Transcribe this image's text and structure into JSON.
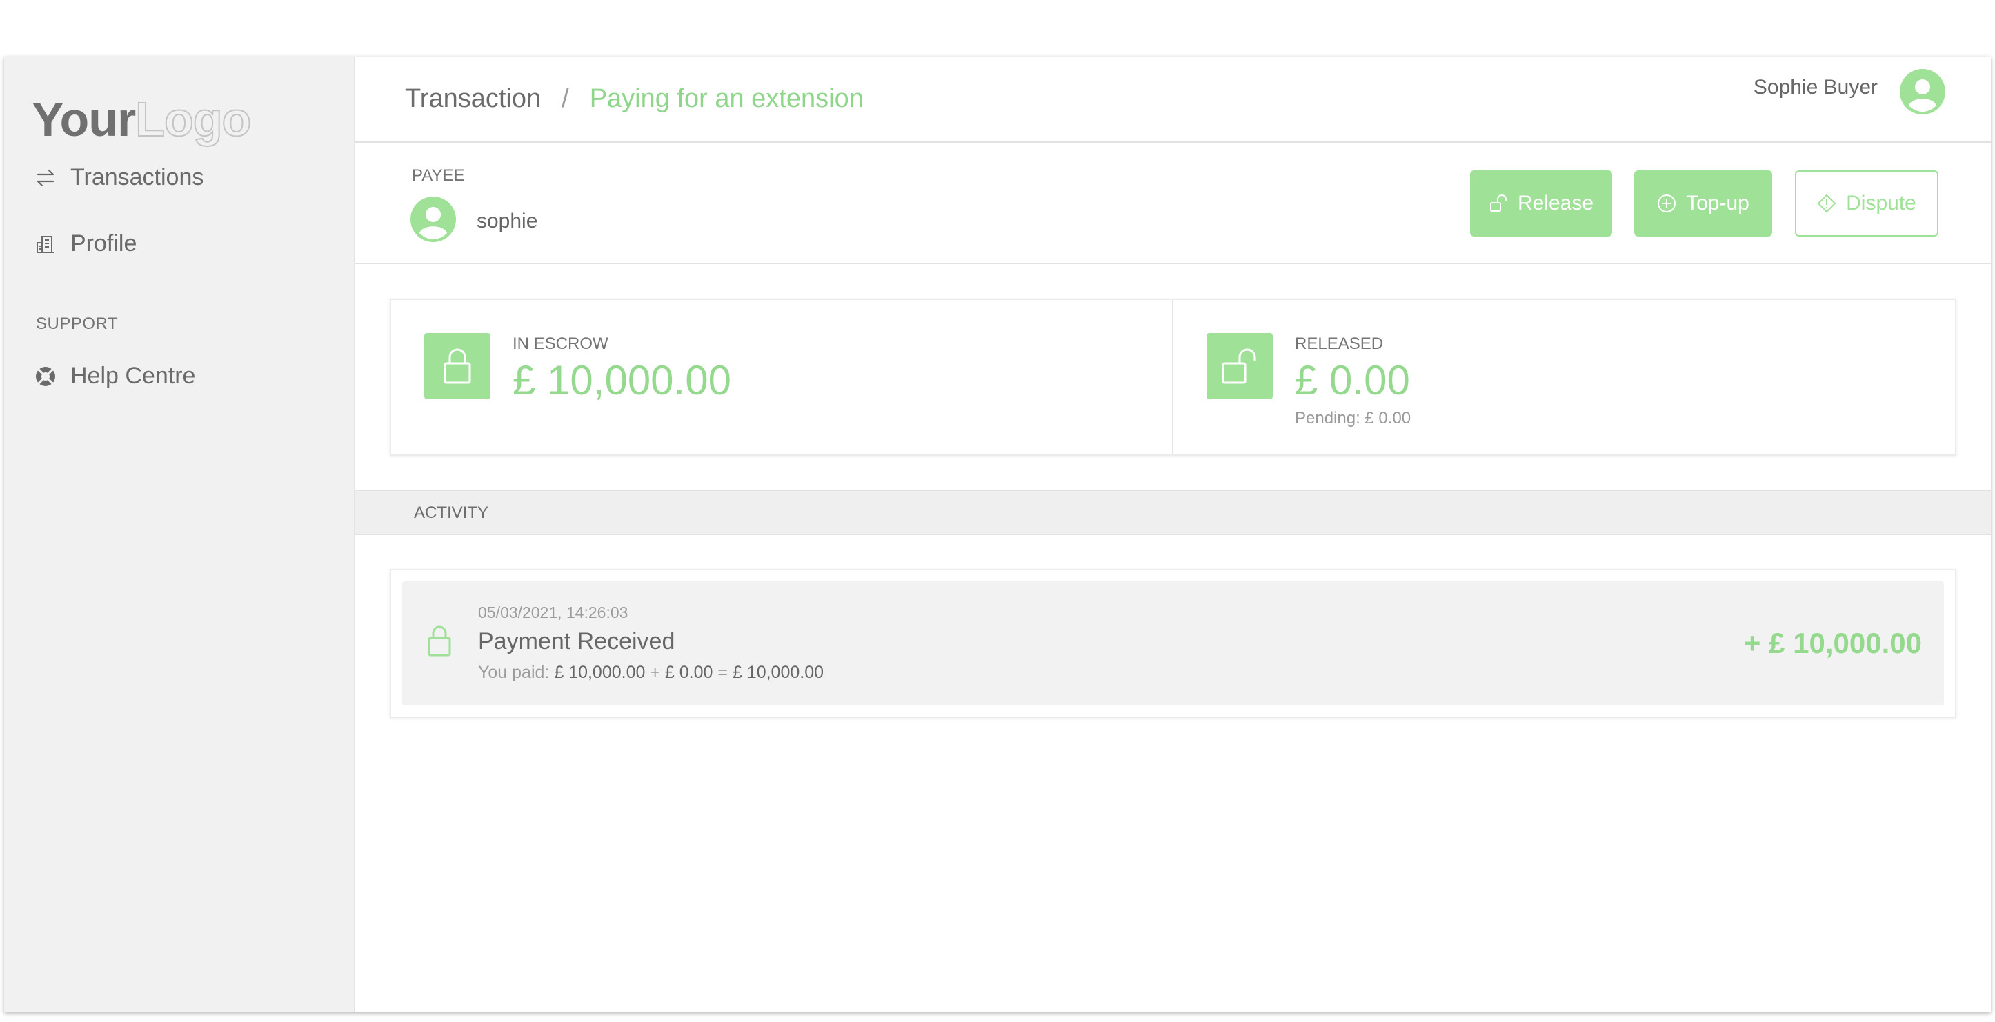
{
  "brand": {
    "logo_part1": "Your",
    "logo_part2": "Logo",
    "accent": "#9ee197"
  },
  "sidebar": {
    "items": [
      {
        "label": "Transactions",
        "icon": "arrows-swap-icon"
      },
      {
        "label": "Profile",
        "icon": "building-icon"
      }
    ],
    "support_label": "SUPPORT",
    "support_items": [
      {
        "label": "Help Centre",
        "icon": "lifebuoy-icon"
      }
    ]
  },
  "header": {
    "breadcrumb_root": "Transaction",
    "breadcrumb_sep": "/",
    "breadcrumb_current": "Paying for an extension",
    "user_name": "Sophie Buyer"
  },
  "payee": {
    "label": "PAYEE",
    "name": "sophie"
  },
  "actions": {
    "release": "Release",
    "topup": "Top-up",
    "dispute": "Dispute"
  },
  "balances": {
    "escrow": {
      "label": "IN ESCROW",
      "amount": "£ 10,000.00"
    },
    "released": {
      "label": "RELEASED",
      "amount": "£ 0.00",
      "pending": "Pending: £ 0.00"
    }
  },
  "activity": {
    "label": "ACTIVITY",
    "items": [
      {
        "date": "05/03/2021, 14:26:03",
        "title": "Payment Received",
        "desc_prefix": "You paid:",
        "desc_a": "£ 10,000.00",
        "desc_plus": "+",
        "desc_b": "£ 0.00",
        "desc_eq": "=",
        "desc_total": "£ 10,000.00",
        "amount": "+ £ 10,000.00"
      }
    ]
  }
}
